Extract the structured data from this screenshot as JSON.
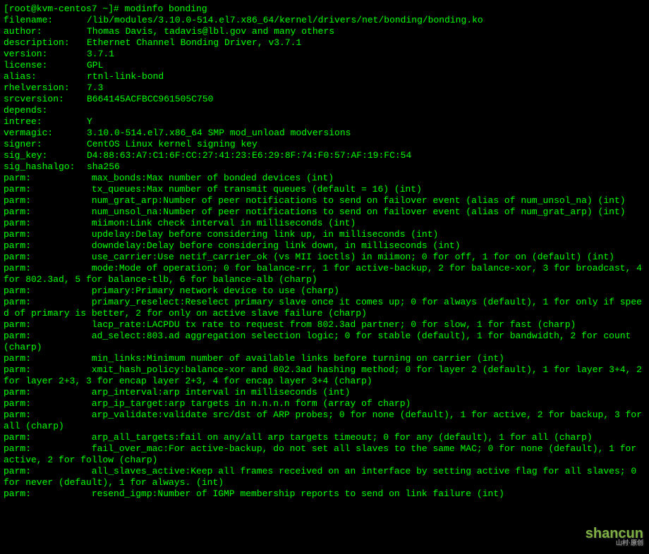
{
  "prompt": "[root@kvm-centos7 ~]# ",
  "command": "modinfo bonding",
  "fields": [
    {
      "k": "filename:",
      "v": "/lib/modules/3.10.0-514.el7.x86_64/kernel/drivers/net/bonding/bonding.ko"
    },
    {
      "k": "author:",
      "v": "Thomas Davis, tadavis@lbl.gov and many others"
    },
    {
      "k": "description:",
      "v": "Ethernet Channel Bonding Driver, v3.7.1"
    },
    {
      "k": "version:",
      "v": "3.7.1"
    },
    {
      "k": "license:",
      "v": "GPL"
    },
    {
      "k": "alias:",
      "v": "rtnl-link-bond"
    },
    {
      "k": "rhelversion:",
      "v": "7.3"
    },
    {
      "k": "srcversion:",
      "v": "B664145ACFBCC961505C750"
    },
    {
      "k": "depends:",
      "v": ""
    },
    {
      "k": "intree:",
      "v": "Y"
    },
    {
      "k": "vermagic:",
      "v": "3.10.0-514.el7.x86_64 SMP mod_unload modversions"
    },
    {
      "k": "signer:",
      "v": "CentOS Linux kernel signing key"
    },
    {
      "k": "sig_key:",
      "v": "D4:88:63:A7:C1:6F:CC:27:41:23:E6:29:8F:74:F0:57:AF:19:FC:54"
    },
    {
      "k": "sig_hashalgo:",
      "v": "sha256"
    }
  ],
  "parm_lines": [
    "parm:           max_bonds:Max number of bonded devices (int)",
    "parm:           tx_queues:Max number of transmit queues (default = 16) (int)",
    "parm:           num_grat_arp:Number of peer notifications to send on failover event (alias of num_unsol_na) (int)",
    "parm:           num_unsol_na:Number of peer notifications to send on failover event (alias of num_grat_arp) (int)",
    "parm:           miimon:Link check interval in milliseconds (int)",
    "parm:           updelay:Delay before considering link up, in milliseconds (int)",
    "parm:           downdelay:Delay before considering link down, in milliseconds (int)",
    "parm:           use_carrier:Use netif_carrier_ok (vs MII ioctls) in miimon; 0 for off, 1 for on (default) (int)",
    "parm:           mode:Mode of operation; 0 for balance-rr, 1 for active-backup, 2 for balance-xor, 3 for broadcast, 4 for 802.3ad, 5 for balance-tlb, 6 for balance-alb (charp)",
    "parm:           primary:Primary network device to use (charp)",
    "parm:           primary_reselect:Reselect primary slave once it comes up; 0 for always (default), 1 for only if speed of primary is better, 2 for only on active slave failure (charp)",
    "parm:           lacp_rate:LACPDU tx rate to request from 802.3ad partner; 0 for slow, 1 for fast (charp)",
    "parm:           ad_select:803.ad aggregation selection logic; 0 for stable (default), 1 for bandwidth, 2 for count (charp)",
    "parm:           min_links:Minimum number of available links before turning on carrier (int)",
    "parm:           xmit_hash_policy:balance-xor and 802.3ad hashing method; 0 for layer 2 (default), 1 for layer 3+4, 2 for layer 2+3, 3 for encap layer 2+3, 4 for encap layer 3+4 (charp)",
    "parm:           arp_interval:arp interval in milliseconds (int)",
    "parm:           arp_ip_target:arp targets in n.n.n.n form (array of charp)",
    "parm:           arp_validate:validate src/dst of ARP probes; 0 for none (default), 1 for active, 2 for backup, 3 for all (charp)",
    "parm:           arp_all_targets:fail on any/all arp targets timeout; 0 for any (default), 1 for all (charp)",
    "parm:           fail_over_mac:For active-backup, do not set all slaves to the same MAC; 0 for none (default), 1 for active, 2 for follow (charp)",
    "parm:           all_slaves_active:Keep all frames received on an interface by setting active flag for all slaves; 0 for never (default), 1 for always. (int)",
    "parm:           resend_igmp:Number of IGMP membership reports to send on link failure (int)"
  ],
  "watermark": "shancun",
  "watermark_sub": "山村·原创"
}
